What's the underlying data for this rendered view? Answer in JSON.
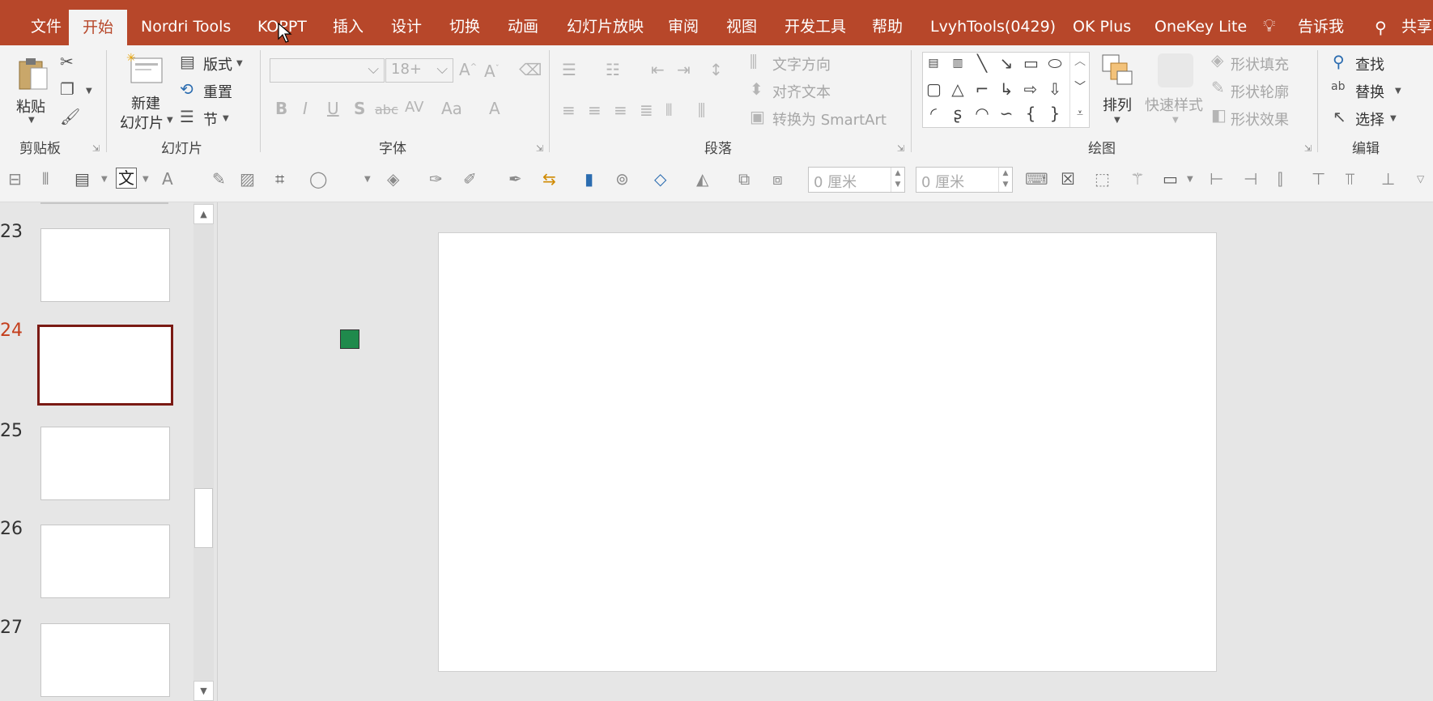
{
  "tabs": [
    "文件",
    "开始",
    "Nordri Tools",
    "KOPPT",
    "插入",
    "设计",
    "切换",
    "动画",
    "幻灯片放映",
    "审阅",
    "视图",
    "开发工具",
    "帮助",
    "LvyhTools(0429)",
    "OK Plus",
    "OneKey Lite"
  ],
  "active_tab": "开始",
  "tell_me": "告诉我",
  "share": "共享",
  "groups": {
    "clipboard": {
      "label": "剪贴板",
      "paste": "粘贴"
    },
    "slides": {
      "label": "幻灯片",
      "new_slide_line1": "新建",
      "new_slide_line2": "幻灯片",
      "layout": "版式",
      "reset": "重置",
      "section": "节"
    },
    "font": {
      "label": "字体",
      "font_size": "18+",
      "buttons": [
        "B",
        "I",
        "U",
        "S",
        "abc",
        "AV",
        "Aa",
        "A"
      ]
    },
    "paragraph": {
      "label": "段落",
      "text_direction": "文字方向",
      "align_text": "对齐文本",
      "convert_smartart": "转换为 SmartArt"
    },
    "drawing": {
      "label": "绘图",
      "arrange": "排列",
      "quick_styles": "快速样式",
      "shape_fill": "形状填充",
      "shape_outline": "形状轮廓",
      "shape_effects": "形状效果"
    },
    "editing": {
      "label": "编辑",
      "find": "查找",
      "replace": "替换",
      "select": "选择"
    }
  },
  "quick_toolbar": {
    "width_value": "0 厘米",
    "height_value": "0 厘米"
  },
  "slides": {
    "numbers": [
      "23",
      "24",
      "25",
      "26",
      "27"
    ],
    "selected": "24"
  }
}
